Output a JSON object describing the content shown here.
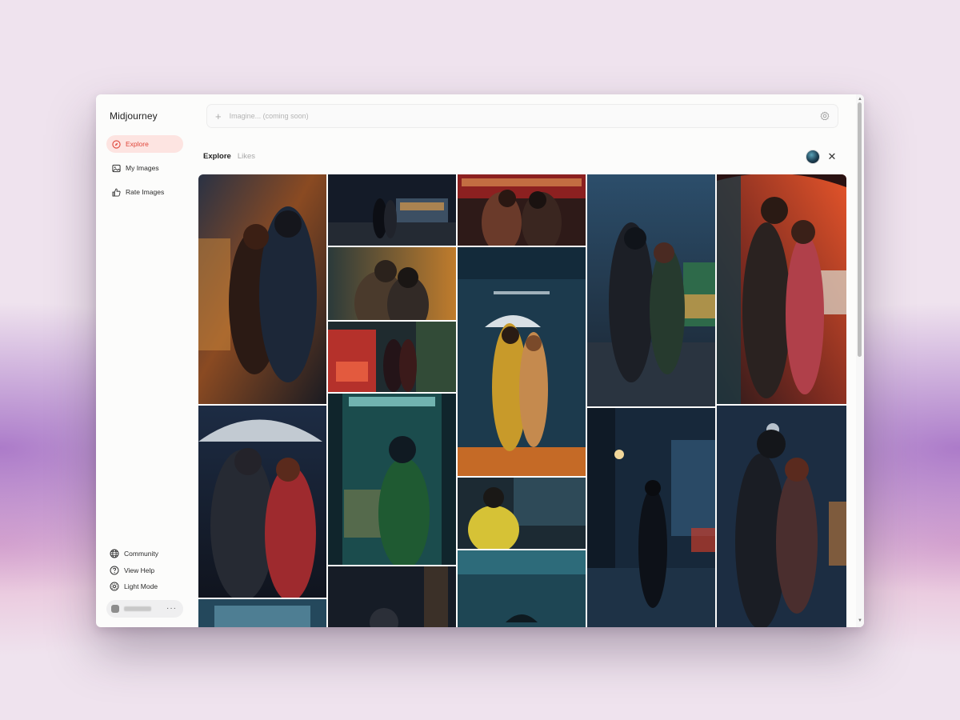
{
  "app": {
    "brand": "Midjourney"
  },
  "sidebar": {
    "items": [
      {
        "label": "Explore",
        "icon": "compass-icon",
        "active": true
      },
      {
        "label": "My Images",
        "icon": "image-icon",
        "active": false
      },
      {
        "label": "Rate Images",
        "icon": "thumbs-up-icon",
        "active": false
      }
    ],
    "footer": [
      {
        "label": "Community",
        "icon": "globe-icon"
      },
      {
        "label": "View Help",
        "icon": "help-circle-icon"
      },
      {
        "label": "Light Mode",
        "icon": "sun-icon"
      }
    ],
    "user": {
      "more": "···"
    }
  },
  "search": {
    "placeholder": "Imagine... (coming soon)",
    "value": ""
  },
  "tabs": [
    {
      "label": "Explore",
      "active": true
    },
    {
      "label": "Likes",
      "active": false
    }
  ],
  "header": {
    "close_glyph": "✕"
  },
  "colors": {
    "accent": "#e0463a",
    "accent_bg": "#fde4e1"
  },
  "gallery": {
    "description_hidden": true,
    "images": [
      "couple-embracing-rain-warm-lights",
      "couple-night-street-bus",
      "women-by-tram-window",
      "couple-kissing-amber-light",
      "couple-by-red-tram",
      "couple-under-umbrella-bus-stop",
      "girl-in-phone-booth-green-coat",
      "woman-yellow-jacket-at-window",
      "night-umbrella-blue-rain",
      "couple-city-street-rain",
      "girl-alone-rainy-boulevard",
      "couple-red-umbrella-standing",
      "couple-night-embrace-blue",
      "couple-umbrella-red-jacket",
      "bus-stop-partial",
      "dark-street-partial"
    ]
  }
}
